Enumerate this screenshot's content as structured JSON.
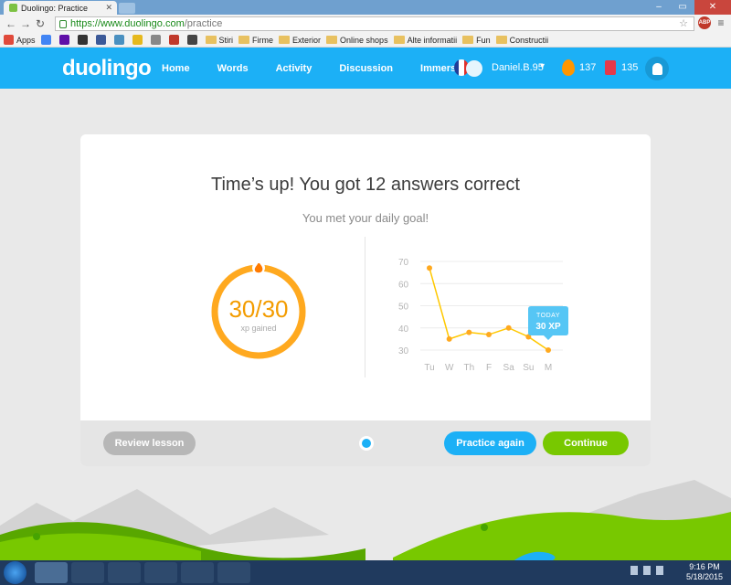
{
  "browser": {
    "tab_title": "Duolingo: Practice",
    "url_secure_part": "https://www.duolingo.com",
    "url_path": "/practice",
    "abp_label": "ABP",
    "window_controls": [
      "–",
      "▭",
      "✕"
    ],
    "bookmarks": [
      {
        "icon": "apps-icon",
        "label": "Apps",
        "color": "#e04a3b"
      },
      {
        "icon": "google-icon",
        "label": "",
        "color": "#4285f4"
      },
      {
        "icon": "yahoo-icon",
        "label": "",
        "color": "#5f0fa8"
      },
      {
        "icon": "site-icon",
        "label": "",
        "color": "#333333"
      },
      {
        "icon": "facebook-icon",
        "label": "",
        "color": "#3b5998"
      },
      {
        "icon": "site-icon",
        "label": "",
        "color": "#4a90c0"
      },
      {
        "icon": "imdb-icon",
        "label": "",
        "color": "#e6b91e"
      },
      {
        "icon": "site-icon",
        "label": "",
        "color": "#888888"
      },
      {
        "icon": "site-icon",
        "label": "",
        "color": "#c0392b"
      },
      {
        "icon": "site-icon",
        "label": "",
        "color": "#444444"
      },
      {
        "icon": "folder-icon",
        "label": "Stiri"
      },
      {
        "icon": "folder-icon",
        "label": "Firme"
      },
      {
        "icon": "folder-icon",
        "label": "Exterior"
      },
      {
        "icon": "folder-icon",
        "label": "Online shops"
      },
      {
        "icon": "folder-icon",
        "label": "Alte informatii"
      },
      {
        "icon": "folder-icon",
        "label": "Fun"
      },
      {
        "icon": "folder-icon",
        "label": "Constructii"
      }
    ]
  },
  "header": {
    "logo": "duolingo",
    "nav": [
      "Home",
      "Words",
      "Activity",
      "Discussion",
      "Immersion"
    ],
    "username": "Daniel.B.95",
    "streak": "137",
    "gems": "135",
    "flag_colors": [
      "#1f3d99",
      "#ffffff",
      "#e0322c"
    ]
  },
  "card": {
    "title": "Time’s up! You got 12 answers correct",
    "subtitle": "You met your daily goal!",
    "xp_score": "30/30",
    "xp_label": "xp gained",
    "xp_progress": 1.0,
    "review_button": "Review lesson",
    "practice_button": "Practice again",
    "continue_button": "Continue"
  },
  "chart_data": {
    "type": "line",
    "categories": [
      "Tu",
      "W",
      "Th",
      "F",
      "Sa",
      "Su",
      "M"
    ],
    "values": [
      67,
      35,
      38,
      37,
      40,
      36,
      30
    ],
    "ylim": [
      30,
      70
    ],
    "yticks": [
      70,
      60,
      50,
      40,
      30
    ],
    "grid": true,
    "annotation": {
      "label": "TODAY",
      "value": "30 XP",
      "category": "M"
    }
  },
  "taskbar": {
    "time": "9:16 PM",
    "date": "5/18/2015"
  },
  "colors": {
    "brand_blue": "#1cb0f6",
    "orange": "#ffa91f",
    "green": "#78c800"
  }
}
